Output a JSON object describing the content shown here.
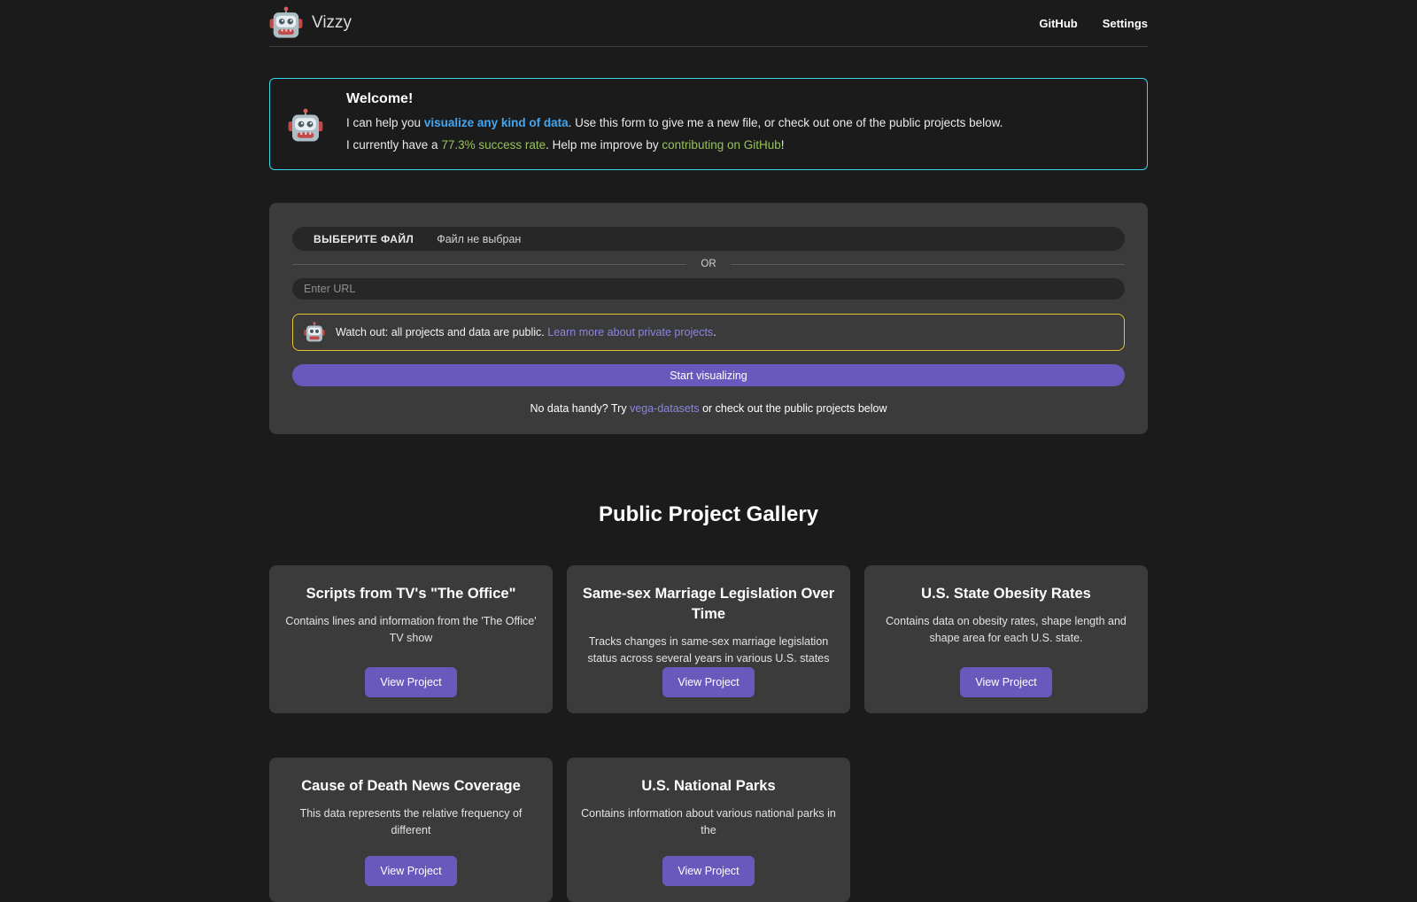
{
  "header": {
    "app_name": "Vizzy",
    "nav": [
      {
        "label": "GitHub"
      },
      {
        "label": "Settings"
      }
    ]
  },
  "welcome": {
    "title": "Welcome!",
    "line1_prefix": "I can help you ",
    "line1_highlight": "visualize any kind of data",
    "line1_suffix": ". Use this form to give me a new file, or check out one of the public projects below.",
    "line2_prefix": "I currently have a ",
    "success_rate": "77.3% success rate",
    "line2_middle": ". Help me improve by ",
    "github_link": "contributing on GitHub",
    "line2_suffix": "!"
  },
  "form": {
    "file_button": "ВЫБЕРИТЕ ФАЙЛ",
    "file_status": "Файл не выбран",
    "divider": "OR",
    "url_placeholder": "Enter URL",
    "warning_prefix": "Watch out: all projects and data are public. ",
    "warning_link": "Learn more about private projects",
    "warning_suffix": ".",
    "submit_label": "Start visualizing",
    "hint_prefix": "No data handy? Try ",
    "hint_link": "vega-datasets",
    "hint_suffix": " or check out the public projects below"
  },
  "gallery": {
    "title": "Public Project Gallery",
    "view_label": "View Project",
    "projects": [
      {
        "title": "Scripts from TV's \"The Office\"",
        "description": "Contains lines and information from the 'The Office' TV show"
      },
      {
        "title": "Same-sex Marriage Legislation Over Time",
        "description": "Tracks changes in same-sex marriage legislation status across several years in various U.S. states"
      },
      {
        "title": "U.S. State Obesity Rates",
        "description": "Contains data on obesity rates, shape length and shape area for each U.S. state."
      },
      {
        "title": "Cause of Death News Coverage",
        "description": "This data represents the relative frequency of different"
      },
      {
        "title": "U.S. National Parks",
        "description": "Contains information about various national parks in the"
      }
    ]
  },
  "icons": {
    "logo": "robot-icon",
    "welcome": "robot-icon",
    "warning": "robot-icon"
  },
  "colors": {
    "page_background": "#1b1b1b",
    "card_background": "#3b3b3b",
    "accent_purple": "#6a59bd",
    "welcome_border_cyan": "#35d6e8",
    "warning_border_yellow": "#e5c32a",
    "highlight_blue": "#41a7f5",
    "success_green": "#97c15c",
    "link_purple": "#8a86dd"
  }
}
